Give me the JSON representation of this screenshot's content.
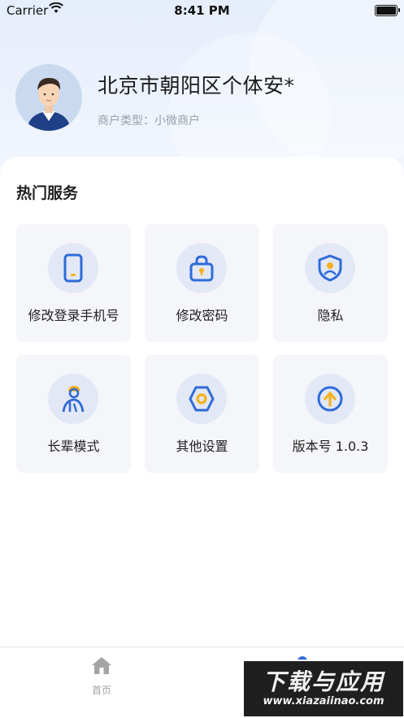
{
  "status_bar": {
    "carrier": "Carrier",
    "time": "8:41 PM"
  },
  "profile": {
    "name": "北京市朝阳区个体安*",
    "merchant_type": "商户类型：小微商户"
  },
  "section": {
    "title": "热门服务"
  },
  "services": [
    {
      "label": "修改登录手机号",
      "icon": "phone-icon"
    },
    {
      "label": "修改密码",
      "icon": "lock-icon"
    },
    {
      "label": "隐私",
      "icon": "shield-user-icon"
    },
    {
      "label": "长辈模式",
      "icon": "elder-icon"
    },
    {
      "label": "其他设置",
      "icon": "settings-hex-icon"
    },
    {
      "label": "版本号 1.0.3",
      "icon": "arrow-up-circle-icon"
    }
  ],
  "tab_bar": {
    "home_label": "首页"
  },
  "watermark": {
    "line1": "下载与应用",
    "line2": "www.xiazaiinao.com"
  },
  "colors": {
    "accent": "#2f6bd8",
    "icon_yellow": "#f5b21c",
    "tile_bg": "#f5f6fa",
    "icon_circle_bg": "#e3e8f6"
  }
}
